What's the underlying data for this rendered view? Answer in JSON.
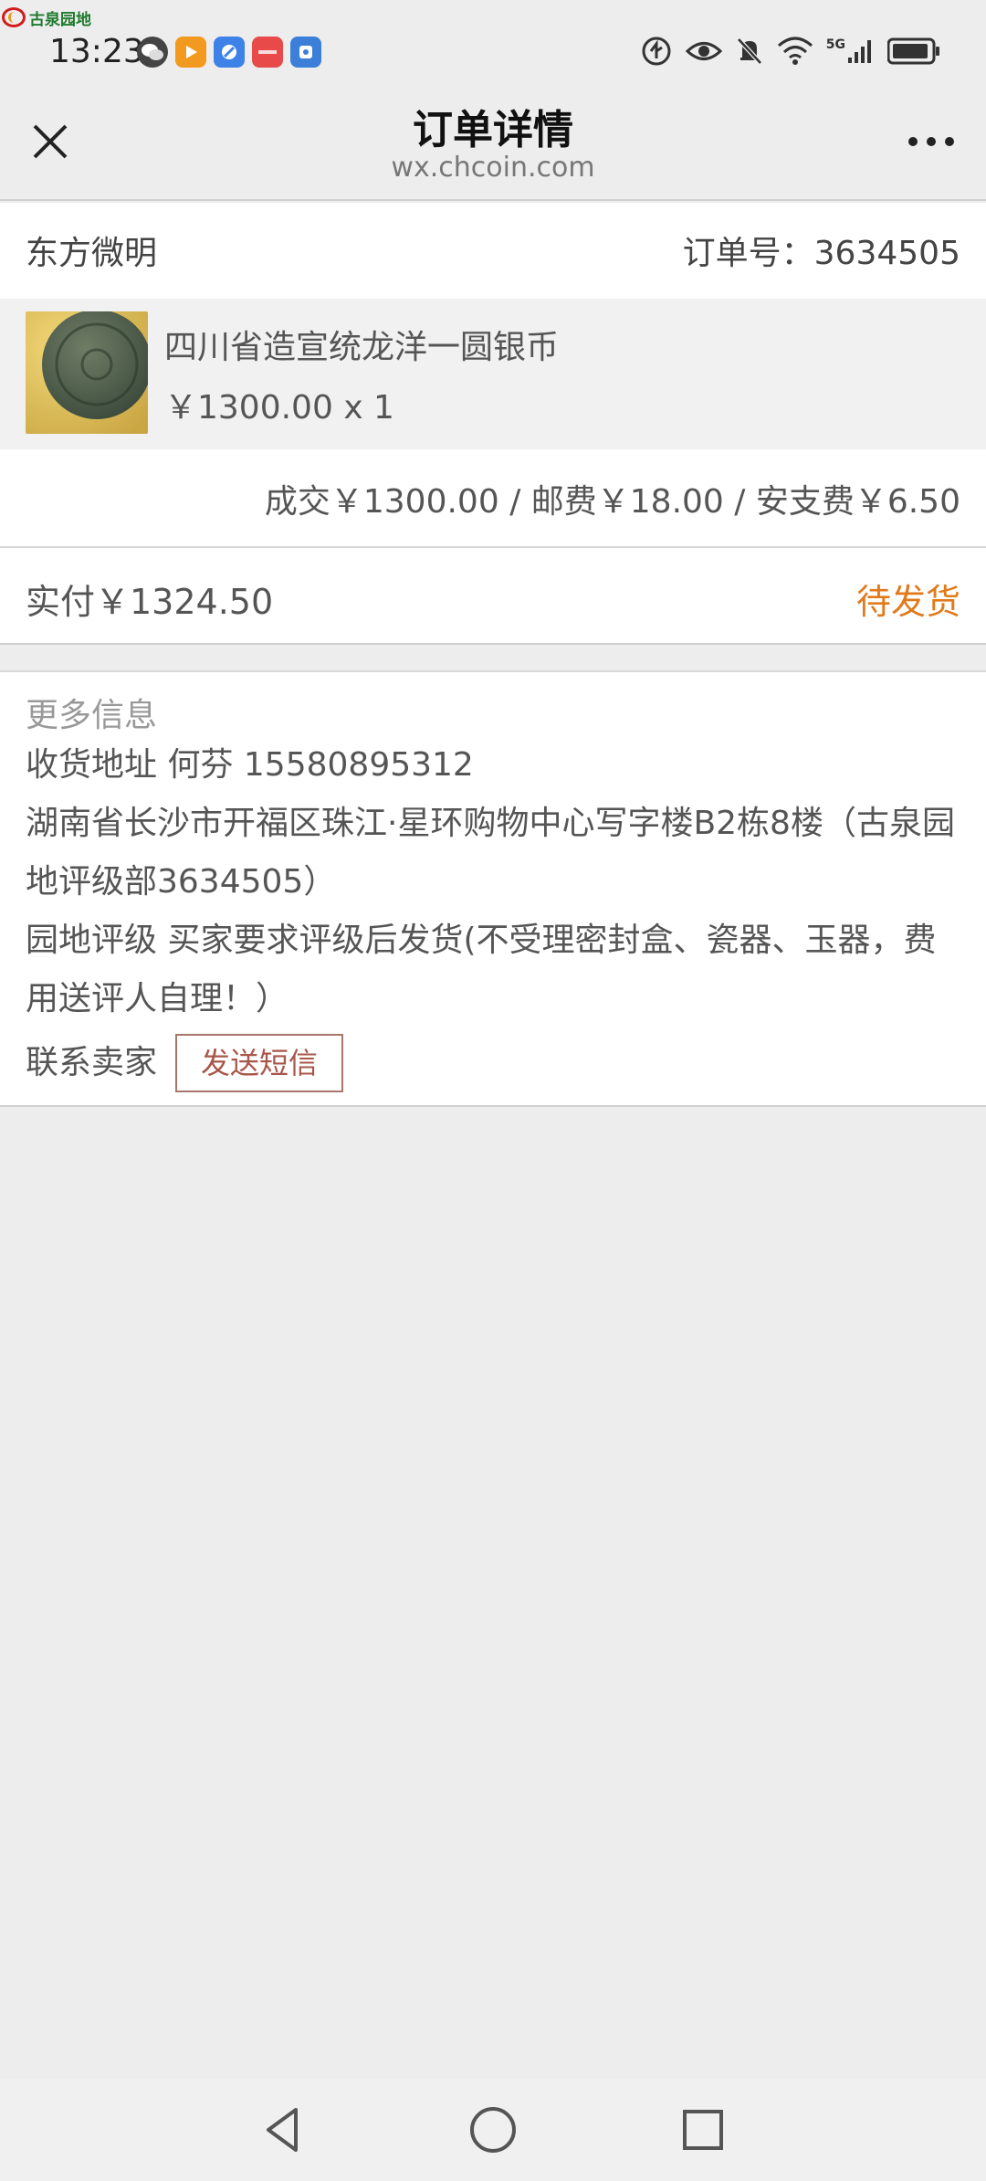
{
  "status_bar": {
    "watermark_text": "古泉园地",
    "time": "13:23",
    "network": "5G"
  },
  "header": {
    "title": "订单详情",
    "subtitle": "wx.chcoin.com"
  },
  "order": {
    "shop_name": "东方微明",
    "order_number": "订单号：3634505",
    "item": {
      "title": "四川省造宣统龙洋一圆银币",
      "price_qty": "￥1300.00 x 1"
    },
    "fees": "成交￥1300.00 / 邮费￥18.00 / 安支费￥6.50",
    "paid": "实付￥1324.50",
    "status": "待发货"
  },
  "more_info": {
    "title": "更多信息",
    "receiver": "收货地址  何芬 15580895312",
    "address": "湖南省长沙市开福区珠江·星环购物中心写字楼B2栋8楼（古泉园地评级部3634505）",
    "grading": "园地评级  买家要求评级后发货(不受理密封盒、瓷器、玉器，费用送评人自理！）",
    "contact_label": "联系卖家",
    "sms_button": "发送短信"
  },
  "colors": {
    "status_orange": "#e07a1b",
    "button_border": "#a8776a",
    "background": "#ededed"
  },
  "icons": [
    "close-icon",
    "more-icon",
    "back-icon",
    "home-icon",
    "recents-icon"
  ]
}
